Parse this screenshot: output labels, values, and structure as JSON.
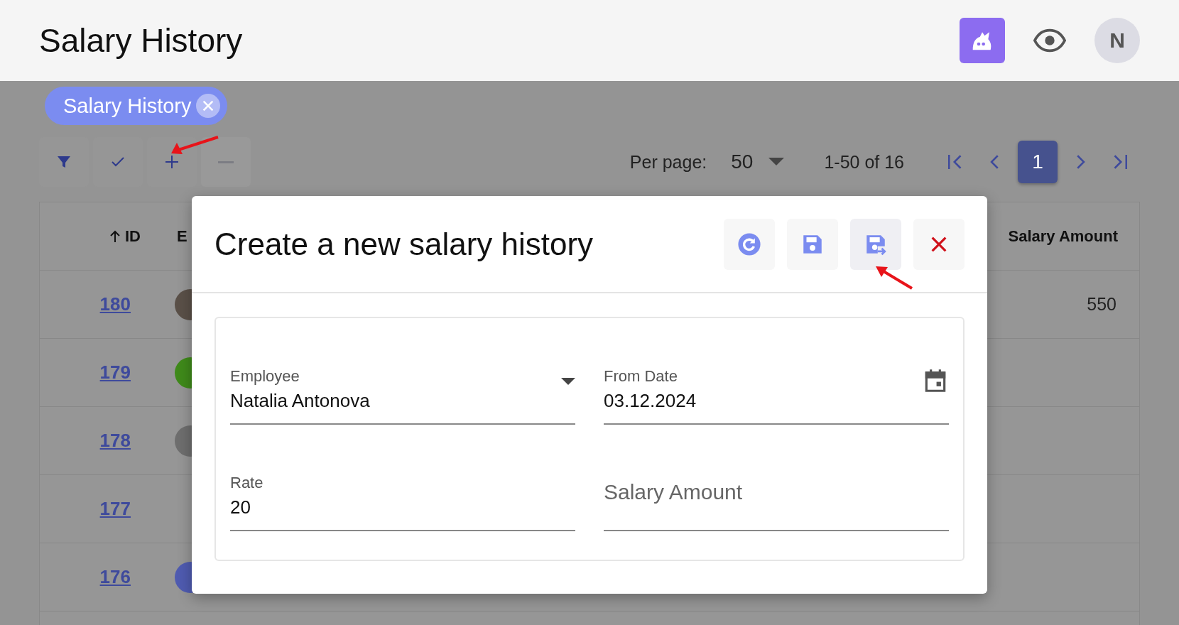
{
  "header": {
    "title": "Salary History",
    "avatar_initial": "N"
  },
  "tabs": [
    {
      "label": "Salary History",
      "selected": true
    }
  ],
  "toolbar": [
    {
      "kind": "filter",
      "disabled": false,
      "highlighted": false
    },
    {
      "kind": "check",
      "disabled": false,
      "highlighted": false
    },
    {
      "kind": "add",
      "disabled": false,
      "highlighted": true
    },
    {
      "kind": "remove",
      "disabled": true,
      "highlighted": false
    }
  ],
  "pagination": {
    "per_page_label": "Per page:",
    "per_page": "50",
    "range": "1-50 of 16",
    "pages": [
      {
        "label": "1",
        "selected": true
      }
    ]
  },
  "table": {
    "columns": [
      {
        "label": "ID",
        "sorted_ascending": true
      },
      {
        "label": "E",
        "sorted_ascending": false
      },
      {
        "label": "Salary Amount",
        "sorted_ascending": false
      }
    ],
    "rows": [
      {
        "id": "180",
        "color": "#5a5048",
        "salary_amount": "550"
      },
      {
        "id": "179",
        "color": "#3f8a1a"
      },
      {
        "id": "178",
        "color": "#6e6e6e"
      },
      {
        "id": "177"
      },
      {
        "id": "176",
        "color": "#4f5bb0"
      }
    ]
  },
  "dialog": {
    "title": "Create a new salary history",
    "actions": [
      {
        "kind": "reset",
        "highlighted": false
      },
      {
        "kind": "save",
        "highlighted": false
      },
      {
        "kind": "save_next",
        "highlighted": true
      },
      {
        "kind": "close",
        "highlighted": false
      }
    ],
    "fields": [
      {
        "kind": "select",
        "label": "Employee",
        "value": "Natalia Antonova"
      },
      {
        "kind": "date",
        "label": "From Date",
        "value": "03.12.2024"
      },
      {
        "kind": "text",
        "label": "Rate",
        "value": "20"
      },
      {
        "kind": "text",
        "placeholder": "Salary Amount"
      }
    ]
  }
}
